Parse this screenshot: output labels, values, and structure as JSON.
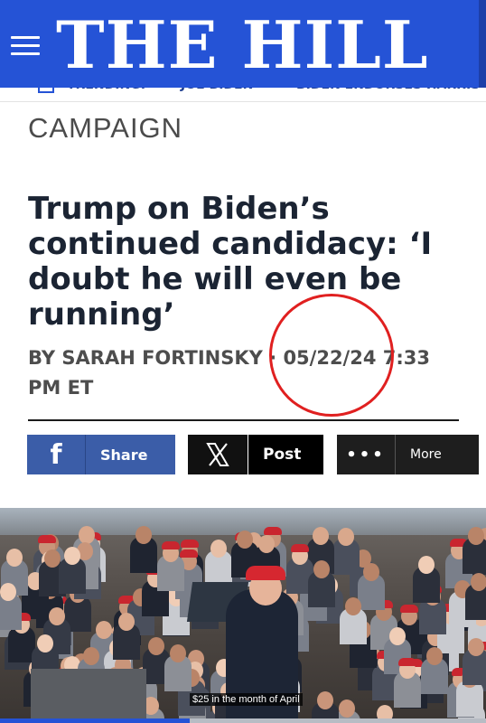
{
  "header": {
    "logo_text": "THE HILL",
    "menu_icon": "hamburger-icon",
    "brand_color": "#2553d6"
  },
  "trending": {
    "label": "TRENDING:",
    "items": [
      "JOE BIDEN",
      "BIDEN ENDORSES HARRIS"
    ]
  },
  "article": {
    "section": "CAMPAIGN",
    "headline": "Trump on Biden’s continued candidacy: ‘I doubt he will even be running’",
    "byline_prefix": "BY ",
    "author": "SARAH FORTINSKY",
    "separator": " · ",
    "timestamp": "05/22/24 7:33 PM ET"
  },
  "share": {
    "facebook": {
      "icon": "facebook-icon",
      "glyph": "f",
      "label": "Share"
    },
    "x": {
      "icon": "x-icon",
      "label": "Post"
    },
    "more": {
      "icon": "ellipsis-icon",
      "glyph": "•••",
      "label": "More"
    }
  },
  "photo": {
    "caption": "$25 in the month of April",
    "progress": 0.39
  },
  "annotation": {
    "circle_color": "#e02020"
  }
}
